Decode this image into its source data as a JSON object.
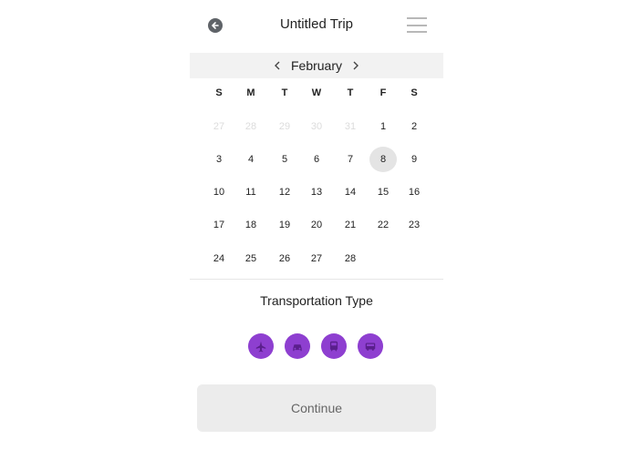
{
  "header": {
    "title": "Untitled Trip",
    "back_icon": "arrow-left-icon",
    "menu_icon": "hamburger-menu-icon"
  },
  "calendar": {
    "month": "February",
    "weekdays": [
      "S",
      "M",
      "T",
      "W",
      "T",
      "F",
      "S"
    ],
    "selected_day": "8",
    "weeks": [
      [
        {
          "d": "27",
          "muted": true
        },
        {
          "d": "28",
          "muted": true
        },
        {
          "d": "29",
          "muted": true
        },
        {
          "d": "30",
          "muted": true
        },
        {
          "d": "31",
          "muted": true
        },
        {
          "d": "1"
        },
        {
          "d": "2"
        }
      ],
      [
        {
          "d": "3"
        },
        {
          "d": "4"
        },
        {
          "d": "5"
        },
        {
          "d": "6"
        },
        {
          "d": "7"
        },
        {
          "d": "8",
          "selected": true
        },
        {
          "d": "9"
        }
      ],
      [
        {
          "d": "10"
        },
        {
          "d": "11"
        },
        {
          "d": "12"
        },
        {
          "d": "13"
        },
        {
          "d": "14"
        },
        {
          "d": "15"
        },
        {
          "d": "16"
        }
      ],
      [
        {
          "d": "17"
        },
        {
          "d": "18"
        },
        {
          "d": "19"
        },
        {
          "d": "20"
        },
        {
          "d": "21"
        },
        {
          "d": "22"
        },
        {
          "d": "23"
        }
      ],
      [
        {
          "d": "24"
        },
        {
          "d": "25"
        },
        {
          "d": "26"
        },
        {
          "d": "27"
        },
        {
          "d": "28"
        }
      ]
    ]
  },
  "transportation": {
    "title": "Transportation Type",
    "options": [
      {
        "name": "plane",
        "icon": "plane-icon"
      },
      {
        "name": "car",
        "icon": "car-icon"
      },
      {
        "name": "train",
        "icon": "train-icon"
      },
      {
        "name": "bus",
        "icon": "bus-icon"
      }
    ],
    "accent": "#8e3fd0"
  },
  "footer": {
    "continue_label": "Continue"
  }
}
